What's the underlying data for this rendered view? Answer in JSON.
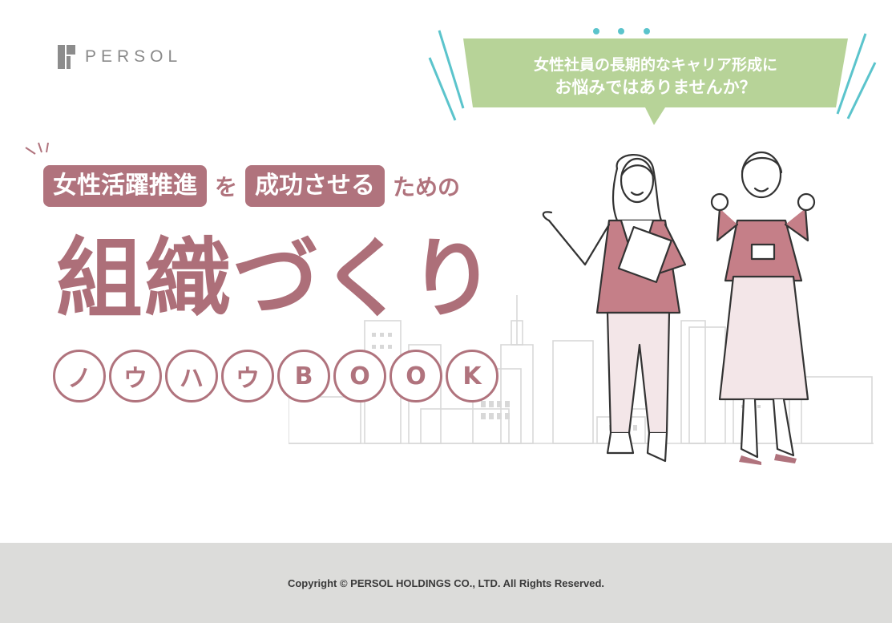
{
  "logo": {
    "text": "PERSOL"
  },
  "bubble": {
    "line1": "女性社員の長期的なキャリア形成に",
    "line2": "お悩みではありませんか？"
  },
  "headline": {
    "tag1": "女性活躍推進",
    "particle1": "を",
    "tag2": "成功させる",
    "suffix": "ための"
  },
  "title": "組織づくり",
  "book_letters": [
    "ノ",
    "ウ",
    "ハ",
    "ウ",
    "B",
    "O",
    "O",
    "K"
  ],
  "footer": {
    "copyright": "Copyright © PERSOL HOLDINGS CO., LTD. All Rights Reserved."
  },
  "colors": {
    "accent": "#b0737d",
    "bubble": "#b7d398",
    "teal": "#5bc4cc",
    "footer_bg": "#dcdcda"
  }
}
